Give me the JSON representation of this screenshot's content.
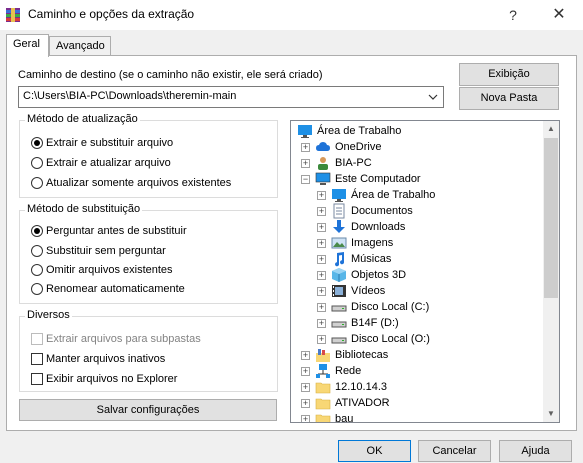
{
  "window": {
    "title": "Caminho e opções da extração",
    "help_glyph": "?",
    "close_glyph": "✕"
  },
  "tabs": [
    {
      "label": "Geral",
      "active": true
    },
    {
      "label": "Avançado",
      "active": false
    }
  ],
  "destination": {
    "label": "Caminho de destino (se o caminho não existir, ele será criado)",
    "value": "C:\\Users\\BIA-PC\\Downloads\\theremin-main"
  },
  "buttons": {
    "exibicao": "Exibição",
    "nova_pasta": "Nova Pasta",
    "salvar": "Salvar configurações",
    "ok": "OK",
    "cancelar": "Cancelar",
    "ajuda": "Ajuda"
  },
  "update_method": {
    "title": "Método de atualização",
    "options": [
      {
        "label": "Extrair e substituir arquivo",
        "selected": true
      },
      {
        "label": "Extrair e atualizar arquivo",
        "selected": false
      },
      {
        "label": "Atualizar somente arquivos existentes",
        "selected": false
      }
    ]
  },
  "overwrite_method": {
    "title": "Método de substituição",
    "options": [
      {
        "label": "Perguntar antes de substituir",
        "selected": true
      },
      {
        "label": "Substituir sem perguntar",
        "selected": false
      },
      {
        "label": "Omitir arquivos existentes",
        "selected": false
      },
      {
        "label": "Renomear automaticamente",
        "selected": false
      }
    ]
  },
  "misc": {
    "title": "Diversos",
    "options": [
      {
        "label": "Extrair arquivos para subpastas",
        "checked": false,
        "disabled": true
      },
      {
        "label": "Manter arquivos inativos",
        "checked": false,
        "disabled": false
      },
      {
        "label": "Exibir arquivos no Explorer",
        "checked": false,
        "disabled": false
      }
    ]
  },
  "tree": {
    "items": [
      {
        "label": "Área de Trabalho",
        "icon": "desktop-icon",
        "level": 0,
        "expander": ""
      },
      {
        "label": "OneDrive",
        "icon": "cloud-icon",
        "level": 1,
        "expander": "+"
      },
      {
        "label": "BIA-PC",
        "icon": "user-icon",
        "level": 1,
        "expander": "+"
      },
      {
        "label": "Este Computador",
        "icon": "computer-icon",
        "level": 1,
        "expander": "−"
      },
      {
        "label": "Área de Trabalho",
        "icon": "desktop-icon",
        "level": 2,
        "expander": "+"
      },
      {
        "label": "Documentos",
        "icon": "document-icon",
        "level": 2,
        "expander": "+"
      },
      {
        "label": "Downloads",
        "icon": "download-icon",
        "level": 2,
        "expander": "+"
      },
      {
        "label": "Imagens",
        "icon": "image-icon",
        "level": 2,
        "expander": "+"
      },
      {
        "label": "Músicas",
        "icon": "music-icon",
        "level": 2,
        "expander": "+"
      },
      {
        "label": "Objetos 3D",
        "icon": "cube-icon",
        "level": 2,
        "expander": "+"
      },
      {
        "label": "Vídeos",
        "icon": "video-icon",
        "level": 2,
        "expander": "+"
      },
      {
        "label": "Disco Local (C:)",
        "icon": "drive-icon",
        "level": 2,
        "expander": "+"
      },
      {
        "label": "B14F (D:)",
        "icon": "drive-icon",
        "level": 2,
        "expander": "+"
      },
      {
        "label": "Disco Local (O:)",
        "icon": "drive-icon",
        "level": 2,
        "expander": "+"
      },
      {
        "label": "Bibliotecas",
        "icon": "library-icon",
        "level": 1,
        "expander": "+"
      },
      {
        "label": "Rede",
        "icon": "network-icon",
        "level": 1,
        "expander": "+"
      },
      {
        "label": "12.10.14.3",
        "icon": "folder-icon",
        "level": 1,
        "expander": "+"
      },
      {
        "label": "ATIVADOR",
        "icon": "folder-icon",
        "level": 1,
        "expander": "+"
      },
      {
        "label": "bau",
        "icon": "folder-icon",
        "level": 1,
        "expander": "+"
      }
    ]
  },
  "colors": {
    "accent": "#0078d7",
    "folder": "#f8d775",
    "desktop": "#1e90e6"
  }
}
